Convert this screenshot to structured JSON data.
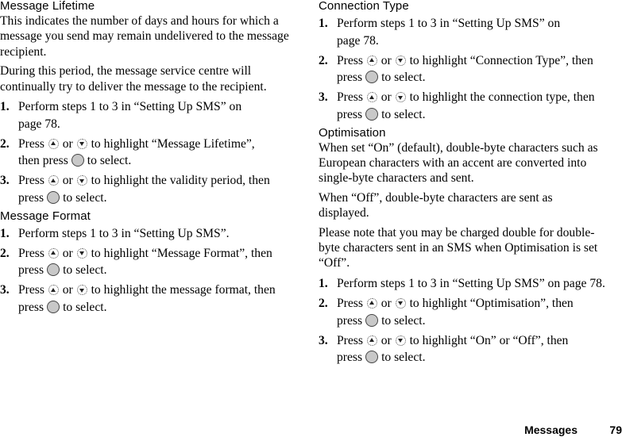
{
  "left_column": {
    "sections": [
      {
        "heading": "Message Lifetime",
        "paragraphs": [
          "This indicates the number of days and hours for which a message you send may remain undelivered to the message recipient.",
          "During this period, the message service centre will continually try to deliver the message to the recipient."
        ],
        "steps": [
          {
            "num": "1.",
            "text": "Perform steps 1 to 3 in “Setting Up SMS” on page 78."
          },
          {
            "num": "2.",
            "pre": "Press",
            "or": "or",
            "mid": "to highlight “Message Lifetime”, then press",
            "post": "to select."
          },
          {
            "num": "3.",
            "pre": "Press",
            "or": "or",
            "mid": "to highlight the validity period, then press",
            "post": "to select."
          }
        ]
      },
      {
        "heading": "Message Format",
        "steps": [
          {
            "num": "1.",
            "text": "Perform steps 1 to 3 in “Setting Up SMS”."
          },
          {
            "num": "2.",
            "pre": "Press",
            "or": "or",
            "mid": "to highlight “Message Format”, then press",
            "post": "to select."
          },
          {
            "num": "3.",
            "pre": "Press",
            "or": "or",
            "mid": "to highlight the message format, then press",
            "post": "to select."
          }
        ]
      }
    ]
  },
  "right_column": {
    "sections": [
      {
        "heading": "Connection Type",
        "steps": [
          {
            "num": "1.",
            "text": "Perform steps 1 to 3 in “Setting Up SMS” on page 78."
          },
          {
            "num": "2.",
            "pre": "Press",
            "or": "or",
            "mid": "to highlight “Connection Type”, then press",
            "post": "to select."
          },
          {
            "num": "3.",
            "pre": "Press",
            "or": "or",
            "mid": "to highlight the connection type, then press",
            "post": "to select."
          }
        ]
      },
      {
        "heading": "Optimisation",
        "paragraphs": [
          "When set “On” (default), double-byte characters such as European characters with an accent are converted into single-byte characters and sent.",
          "When “Off”, double-byte characters are sent as displayed.",
          "Please note that you may be charged double for double-byte characters sent in an SMS when Optimisation is set “Off”."
        ],
        "steps": [
          {
            "num": "1.",
            "text": "Perform steps 1 to 3 in “Setting Up SMS” on page 78."
          },
          {
            "num": "2.",
            "pre": "Press",
            "or": "or",
            "mid": "to highlight “Optimisation”, then press",
            "post": "to select."
          },
          {
            "num": "3.",
            "pre": "Press",
            "or": "or",
            "mid": "to highlight “On” or “Off”, then press",
            "post": "to select."
          }
        ]
      }
    ]
  },
  "icons": {
    "up_key": "nav-up-key-icon",
    "down_key": "nav-down-key-icon",
    "select_key": "center-select-key-icon"
  },
  "footer": {
    "section": "Messages",
    "page_number": "79"
  }
}
